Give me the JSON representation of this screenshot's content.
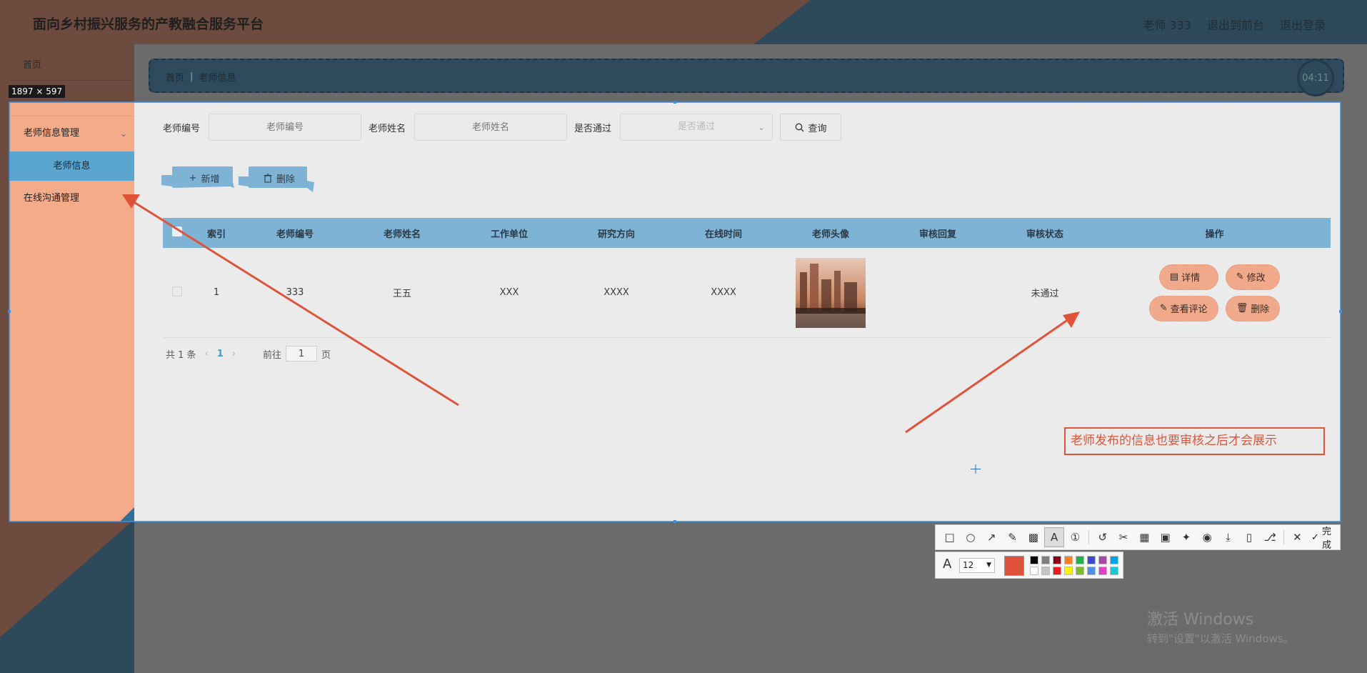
{
  "header": {
    "title": "面向乡村振兴服务的产教融合服务平台",
    "nav": [
      "老师 333",
      "退出到前台",
      "退出登录"
    ]
  },
  "breadcrumb": {
    "home": "首页",
    "current": "老师信息"
  },
  "clock": "04:11",
  "capture_size_label": "1897 × 597",
  "sidebar": {
    "home": "首页",
    "group": "老师信息管理",
    "active_item": "老师信息",
    "chat": "在线沟通管理"
  },
  "filters": {
    "teacher_no_label": "老师编号",
    "teacher_no_placeholder": "老师编号",
    "teacher_name_label": "老师姓名",
    "teacher_name_placeholder": "老师姓名",
    "passed_label": "是否通过",
    "passed_placeholder": "是否通过",
    "query_label": "查询"
  },
  "actions": {
    "add_label": "新增",
    "delete_label": "删除"
  },
  "table": {
    "columns": [
      "索引",
      "老师编号",
      "老师姓名",
      "工作单位",
      "研究方向",
      "在线时间",
      "老师头像",
      "审核回复",
      "审核状态",
      "操作"
    ],
    "rows": [
      {
        "index": "1",
        "teacher_no": "333",
        "teacher_name": "王五",
        "work_unit": "XXX",
        "research": "XXXX",
        "online_time": "XXXX",
        "avatar": "avatar-image",
        "review_reply": "",
        "review_status": "未通过",
        "ops": [
          "详情",
          "修改",
          "查看评论",
          "删除"
        ]
      }
    ]
  },
  "pager": {
    "total": "共 1 条",
    "current_page": "1",
    "goto_label": "前往",
    "goto_value": "1",
    "page_suffix": "页"
  },
  "annotation_text": "老师发布的信息也要审核之后才会展示",
  "toolbar": {
    "done_label": "完成",
    "font_size": "12"
  },
  "colors": {
    "accent_red": "#e0533b",
    "sidebar_bg": "#f4ab8a",
    "active_menu": "#5aa6cf",
    "table_header": "#7fb3d5",
    "palette": [
      "#000000",
      "#7f7f7f",
      "#880015",
      "#ff7f27",
      "#22b14c",
      "#3f48cc",
      "#a349a4",
      "#00a2e8",
      "#ffffff",
      "#c3c3c3",
      "#ed1c24",
      "#fff200",
      "#7cbb2c",
      "#4f8fe6",
      "#e040c8",
      "#16c8d6"
    ]
  },
  "watermark": {
    "line1": "激活 Windows",
    "line2": "转到\"设置\"以激活 Windows。"
  }
}
